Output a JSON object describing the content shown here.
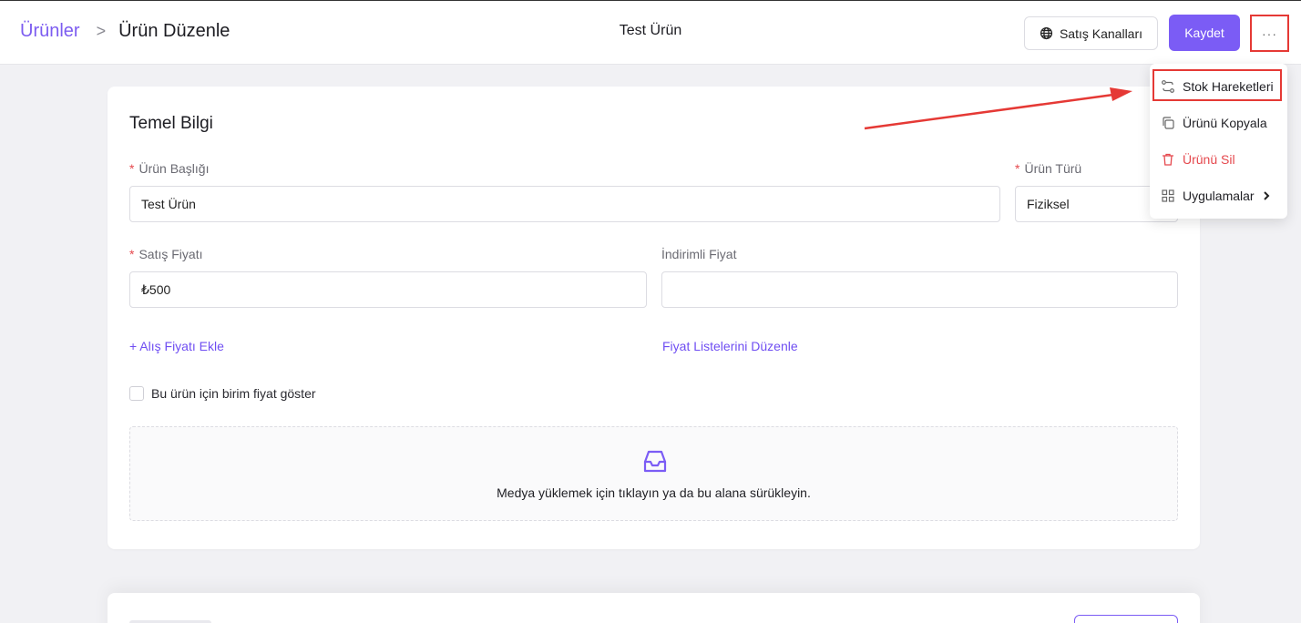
{
  "breadcrumb": {
    "root": "Ürünler",
    "separator": ">",
    "current": "Ürün Düzenle"
  },
  "header": {
    "title": "Test Ürün",
    "channels_label": "Satış Kanalları",
    "channels_icon": "globe-icon",
    "save_label": "Kaydet",
    "more_label": "···"
  },
  "form": {
    "section_title": "Temel Bilgi",
    "required_mark": "*",
    "title_label": "Ürün Başlığı",
    "title_value": "Test Ürün",
    "type_label": "Ürün Türü",
    "type_value": "Fiziksel",
    "price_label": "Satış Fiyatı",
    "price_value": "₺500",
    "discount_label": "İndirimli Fiyat",
    "discount_value": "",
    "add_purchase_price": "+ Alış Fiyatı Ekle",
    "edit_price_lists": "Fiyat Listelerini Düzenle",
    "unit_price_checkbox": "Bu ürün için birim fiyat göster",
    "unit_price_checked": false,
    "media_text": "Medya yüklemek için tıklayın ya da bu alana sürükleyin.",
    "media_icon": "inbox-icon"
  },
  "menu": {
    "items": [
      {
        "label": "Stok Hareketleri",
        "icon": "stock-movements-icon"
      },
      {
        "label": "Ürünü Kopyala",
        "icon": "copy-icon"
      },
      {
        "label": "Ürünü Sil",
        "icon": "trash-icon",
        "danger": true
      },
      {
        "label": "Uygulamalar",
        "icon": "grid-icon",
        "submenu": true
      }
    ]
  },
  "colors": {
    "accent": "#7b5cf5",
    "link": "#6f4ef2",
    "danger": "#e5484d",
    "annotation": "#e53935"
  }
}
